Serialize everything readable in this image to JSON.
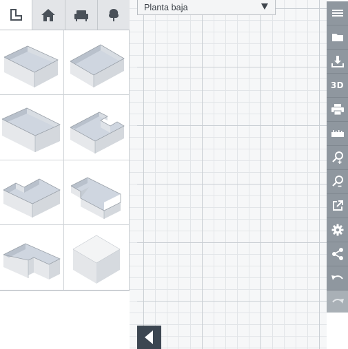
{
  "floor_selector": {
    "value": "Planta baja"
  },
  "category_tabs": [
    {
      "icon": "room-shape-icon",
      "active": true
    },
    {
      "icon": "house-icon",
      "active": false
    },
    {
      "icon": "armchair-icon",
      "active": false
    },
    {
      "icon": "tree-icon",
      "active": false
    }
  ],
  "room_templates": [
    {
      "icon": "rectangular-room-icon"
    },
    {
      "icon": "square-room-icon"
    },
    {
      "icon": "long-rectangular-room-icon"
    },
    {
      "icon": "notched-room-icon"
    },
    {
      "icon": "l-shaped-room-icon"
    },
    {
      "icon": "step-shaped-room-icon"
    },
    {
      "icon": "corner-room-icon"
    },
    {
      "icon": "solid-cube-icon"
    }
  ],
  "toolbar": {
    "view_3d_label": "3D",
    "buttons": [
      {
        "icon": "menu-icon"
      },
      {
        "icon": "folder-icon"
      },
      {
        "icon": "download-icon"
      },
      {
        "icon": "view-3d-icon"
      },
      {
        "icon": "print-icon"
      },
      {
        "icon": "ruler-icon"
      },
      {
        "icon": "zoom-in-icon"
      },
      {
        "icon": "zoom-out-icon"
      },
      {
        "icon": "open-external-icon"
      },
      {
        "icon": "settings-icon"
      },
      {
        "icon": "share-icon"
      },
      {
        "icon": "undo-icon"
      },
      {
        "icon": "redo-icon",
        "disabled": true
      }
    ]
  },
  "colors": {
    "toolbar": "#8f979f",
    "collapse_button": "#3c4651",
    "panel_bg": "#f4f5f6",
    "grid_major": "#c9ced3",
    "grid_minor": "#e2e5e8"
  }
}
